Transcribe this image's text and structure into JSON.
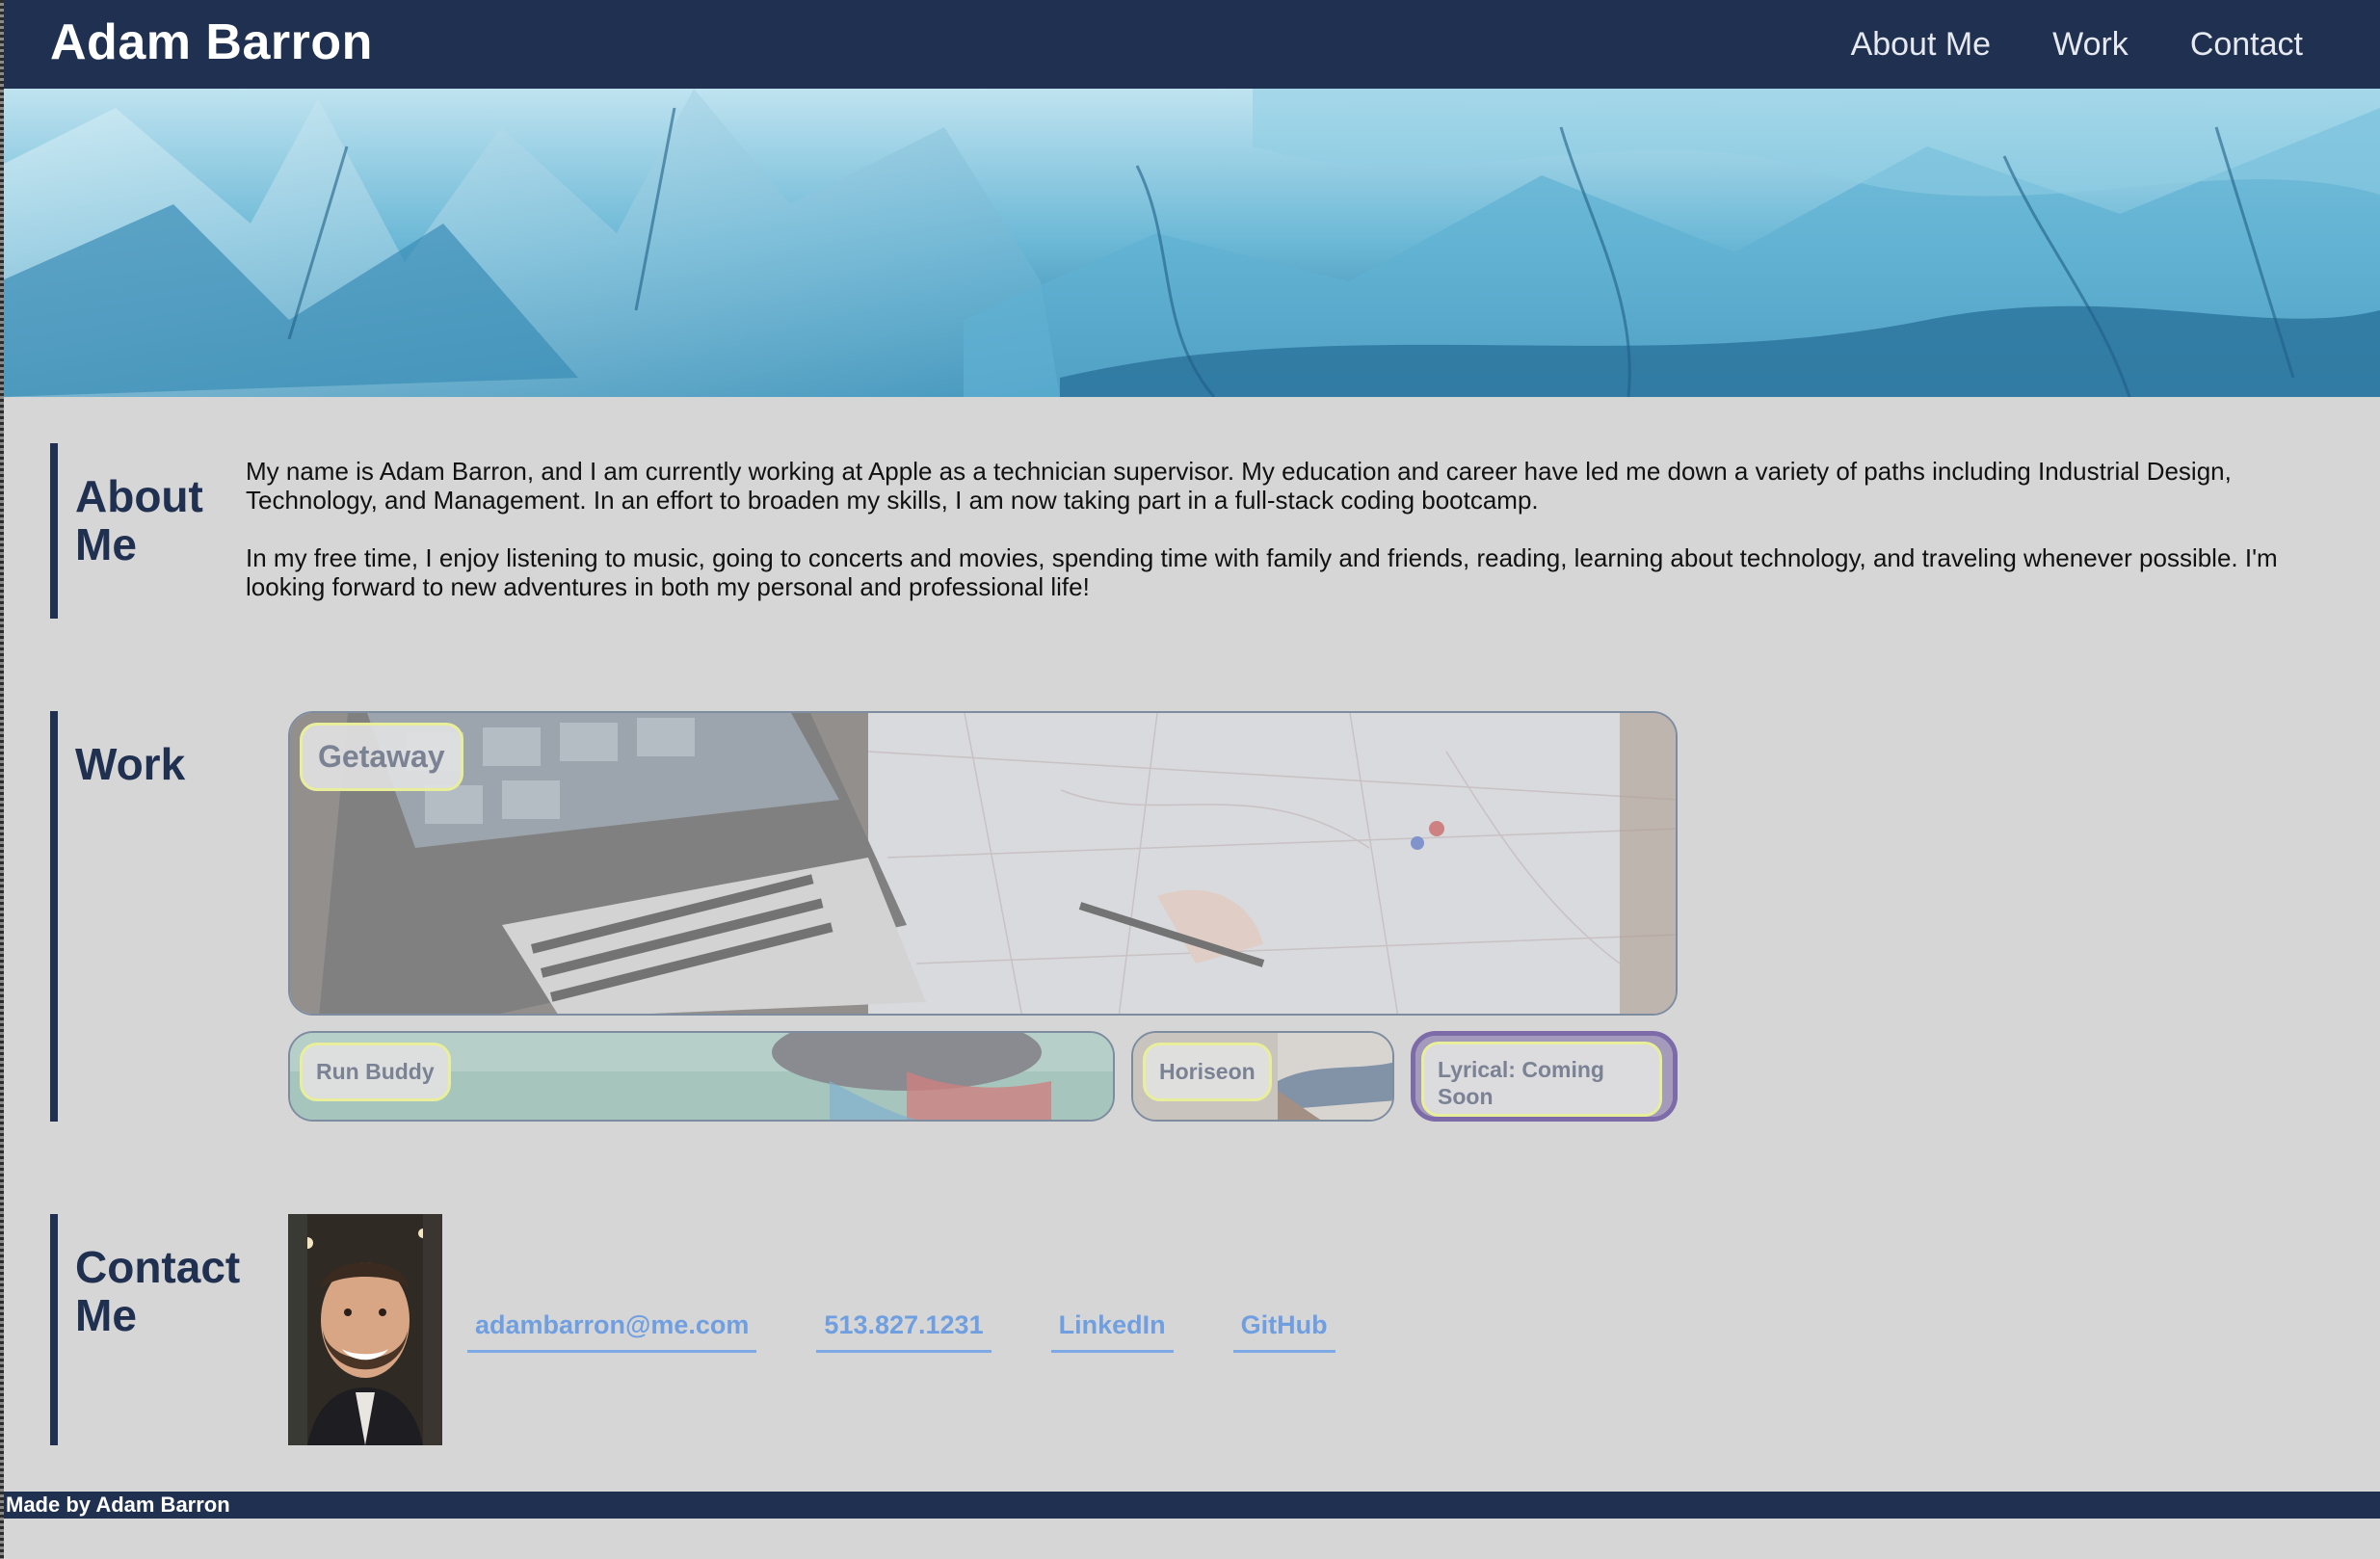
{
  "header": {
    "title": "Adam Barron",
    "nav": [
      "About Me",
      "Work",
      "Contact"
    ]
  },
  "about": {
    "heading": "About Me",
    "paragraphs": [
      "My name is Adam Barron, and I am currently working at Apple as a technician supervisor. My education and career have led me down a variety of paths including Industrial Design, Technology, and Management. In an effort to broaden my skills, I am now taking part in a full-stack coding bootcamp.",
      "In my free time, I enjoy listening to music, going to concerts and movies, spending time with family and friends, reading, learning about technology, and traveling whenever possible. I'm looking forward to new adventures in both my personal and professional life!"
    ]
  },
  "work": {
    "heading": "Work",
    "projects": [
      "Getaway",
      "Run Buddy",
      "Horiseon",
      "Lyrical: Coming Soon"
    ]
  },
  "contact": {
    "heading": "Contact Me",
    "links": [
      "adambarron@me.com",
      "513.827.1231",
      "LinkedIn",
      "GitHub"
    ]
  },
  "footer": {
    "text": "Made by Adam Barron"
  },
  "colors": {
    "navy": "#203050",
    "page_bg": "#d6d6d6",
    "link_blue": "#6f9fe0",
    "label_border": "#e8ee9a"
  }
}
